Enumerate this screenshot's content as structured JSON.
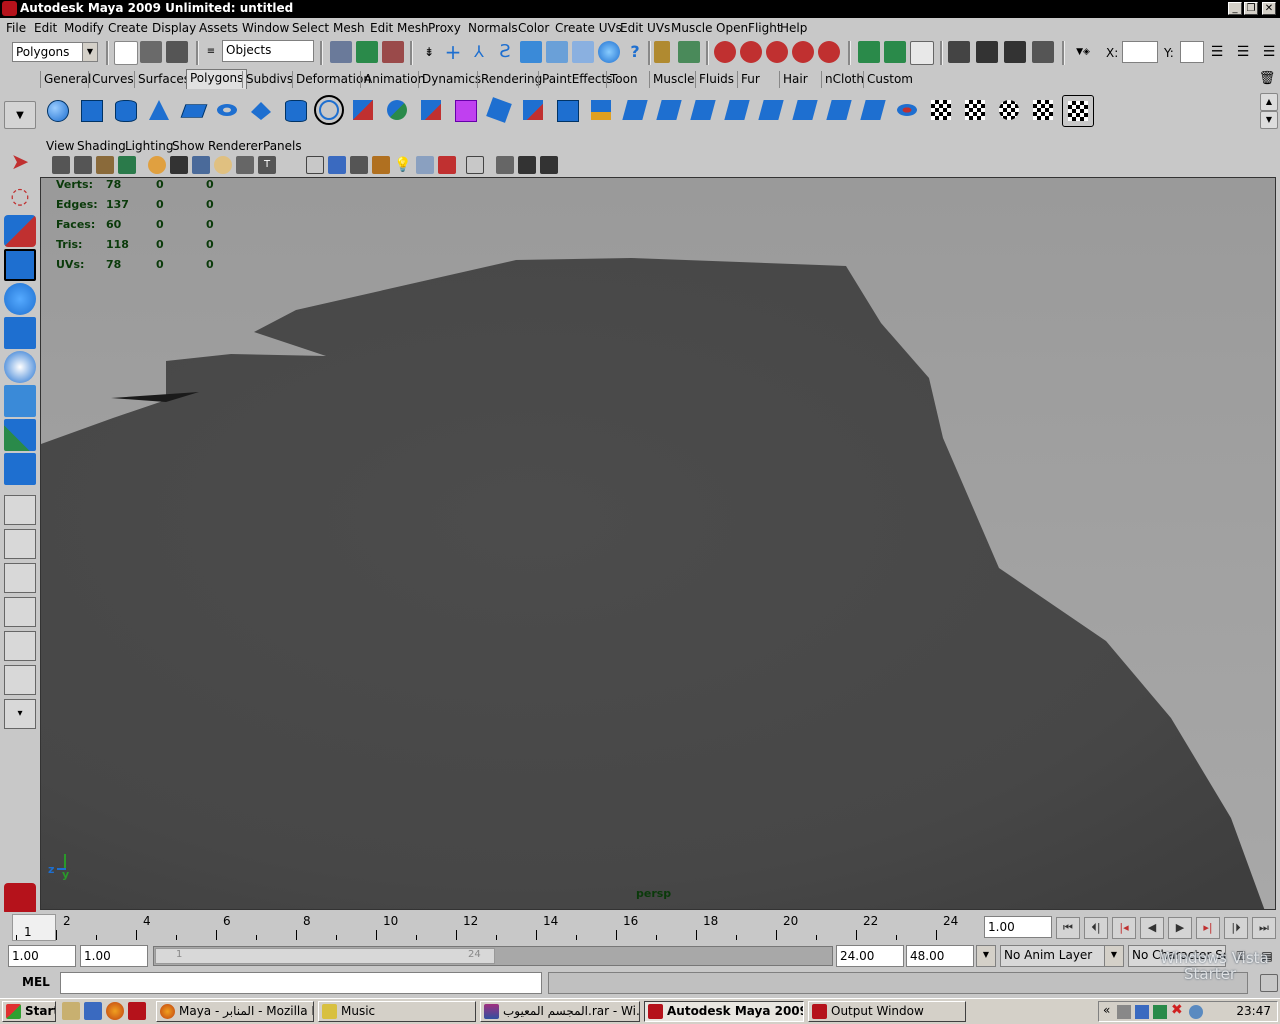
{
  "window": {
    "title": "Autodesk Maya 2009 Unlimited: untitled",
    "buttons": [
      "_",
      "❐",
      "✕"
    ]
  },
  "menubar": [
    "File",
    "Edit",
    "Modify",
    "Create",
    "Display",
    "Assets",
    "Window",
    "Select",
    "Mesh",
    "Edit Mesh",
    "Proxy",
    "Normals",
    "Color",
    "Create UVs",
    "Edit UVs",
    "Muscle",
    "OpenFlight",
    "Help"
  ],
  "statusline": {
    "menuset": "Polygons",
    "selection_mode": "Objects",
    "x_label": "X:",
    "y_label": "Y:"
  },
  "shelf_tabs": {
    "items": [
      "General",
      "Curves",
      "Surfaces",
      "Polygons",
      "Subdivs",
      "Deformation",
      "Animation",
      "Dynamics",
      "Rendering",
      "PaintEffects",
      "Toon",
      "Muscle",
      "Fluids",
      "Fur",
      "Hair",
      "nCloth",
      "Custom"
    ],
    "active": "Polygons"
  },
  "panel_menu": [
    "View",
    "Shading",
    "Lighting",
    "Show",
    "Renderer",
    "Panels"
  ],
  "hud": {
    "rows": [
      {
        "label": "Verts:",
        "v1": "78",
        "v2": "0",
        "v3": "0"
      },
      {
        "label": "Edges:",
        "v1": "137",
        "v2": "0",
        "v3": "0"
      },
      {
        "label": "Faces:",
        "v1": "60",
        "v2": "0",
        "v3": "0"
      },
      {
        "label": "Tris:",
        "v1": "118",
        "v2": "0",
        "v3": "0"
      },
      {
        "label": "UVs:",
        "v1": "78",
        "v2": "0",
        "v3": "0"
      }
    ],
    "camera": "persp",
    "axis_z": "z",
    "axis_y": "y"
  },
  "timeline": {
    "labels": [
      "2",
      "4",
      "6",
      "8",
      "10",
      "12",
      "14",
      "16",
      "18",
      "20",
      "22",
      "24"
    ],
    "current_frame": "1",
    "current_time_field": "1.00"
  },
  "range": {
    "start": "1.00",
    "anim_start": "1.00",
    "slider_start": "1",
    "slider_end": "24",
    "anim_end": "24.00",
    "end": "48.00",
    "anim_layer": "No Anim Layer",
    "character_set": "No Character Set"
  },
  "cmdline": {
    "label": "MEL"
  },
  "taskbar": {
    "start": "Start",
    "tasks": [
      {
        "label": "Maya - المنابر - Mozilla Fir...",
        "active": false
      },
      {
        "label": "Music",
        "active": false
      },
      {
        "label": "المجسم المعيوب.rar - Wi...",
        "active": false
      },
      {
        "label": "Autodesk Maya 2009 ...",
        "active": true
      },
      {
        "label": "Output Window",
        "active": false
      }
    ],
    "clock": "23:47",
    "watermark_line1": "Windows Vista",
    "watermark_line2": "Starter"
  },
  "colors": {
    "viewport_bg": "#a0a0a0",
    "mesh": "#4a4a4a",
    "hud_text": "#0a3a0a",
    "maya_red": "#b5121b",
    "icon_blue": "#1e6fd0"
  }
}
